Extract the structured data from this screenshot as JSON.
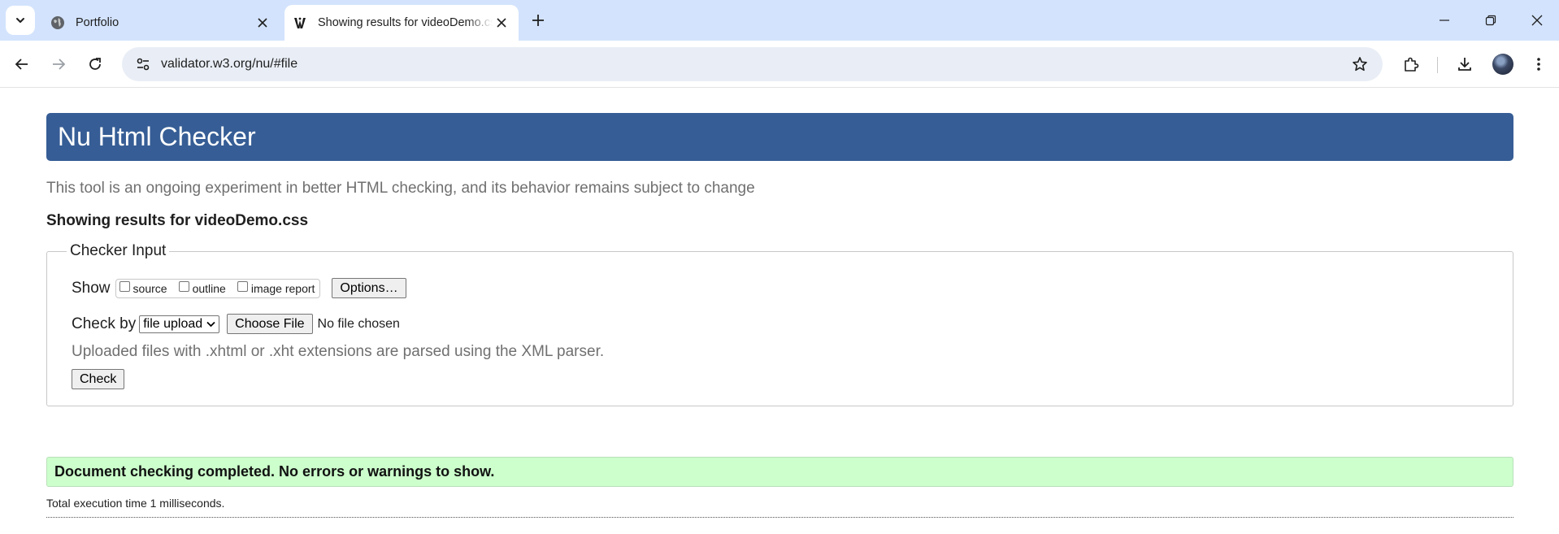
{
  "browser": {
    "tabs": [
      {
        "title": "Portfolio",
        "active": false,
        "favicon": "globe-icon"
      },
      {
        "title": "Showing results for videoDemo.css",
        "active": true,
        "favicon": "w3c-validator-icon"
      }
    ],
    "url": "validator.w3.org/nu/#file"
  },
  "page": {
    "banner_title": "Nu Html Checker",
    "tagline": "This tool is an ongoing experiment in better HTML checking, and its behavior remains subject to change",
    "showing_results": "Showing results for videoDemo.css",
    "checker_input": {
      "legend": "Checker Input",
      "show_label": "Show",
      "show_options": [
        {
          "label": "source",
          "checked": false
        },
        {
          "label": "outline",
          "checked": false
        },
        {
          "label": "image report",
          "checked": false
        }
      ],
      "options_button": "Options…",
      "check_by_label": "Check by",
      "check_by_selected": "file upload",
      "choose_file_button": "Choose File",
      "no_file_text": "No file chosen",
      "hint": "Uploaded files with .xhtml or .xht extensions are parsed using the XML parser.",
      "check_button": "Check"
    },
    "result_message": "Document checking completed. No errors or warnings to show.",
    "execution_time": "Total execution time 1 milliseconds."
  },
  "colors": {
    "tabstrip": "#d3e3fd",
    "banner": "#365d95",
    "success_bg": "#ccffcc",
    "muted_text": "#707070"
  }
}
